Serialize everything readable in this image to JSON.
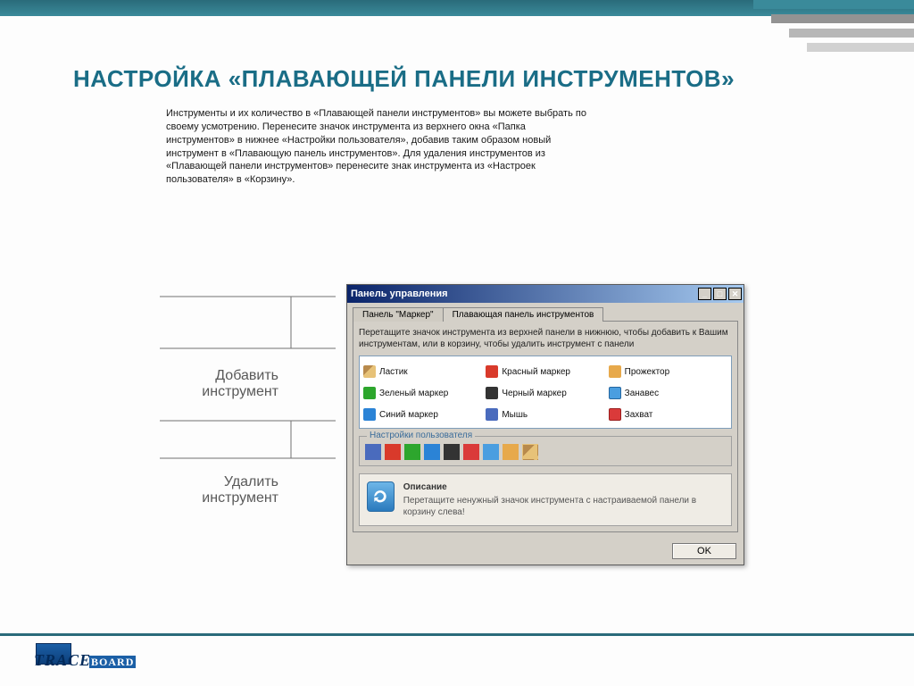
{
  "heading": "Настройка «плавающей панели инструментов»",
  "intro": "Инструменты и их количество в «Плавающей панели инструментов» вы можете выбрать по своему усмотрению. Перенесите значок инструмента из верхнего окна «Папка инструментов» в нижнее «Настройки пользователя», добавив таким образом новый инструмент в «Плавающую панель инструментов». Для удаления инструментов из «Плавающей панели инструментов» перенесите знак инструмента из «Настроек пользователя» в «Корзину».",
  "labels": {
    "add": "Добавить инструмент",
    "remove": "Удалить инструмент"
  },
  "window": {
    "title": "Панель управления",
    "tabs": [
      "Панель \"Маркер\"",
      "Плавающая панель инструментов"
    ],
    "hint": "Перетащите значок инструмента из верхней панели в нижнюю, чтобы добавить к Вашим инструментам, или в корзину, чтобы удалить инструмент с панели",
    "tools": [
      "Ластик",
      "Красный маркер",
      "Прожектор",
      "Зеленый маркер",
      "Черный маркер",
      "Занавес",
      "Синий маркер",
      "Мышь",
      "Захват"
    ],
    "userSettingsLabel": "Настройки пользователя",
    "desc": {
      "title": "Описание",
      "body": "Перетащите ненужный значок инструмента с настраиваемой панели в корзину слева!"
    },
    "ok": "OK"
  },
  "logo": {
    "brand": "TRACE",
    "suffix": "BOARD"
  }
}
